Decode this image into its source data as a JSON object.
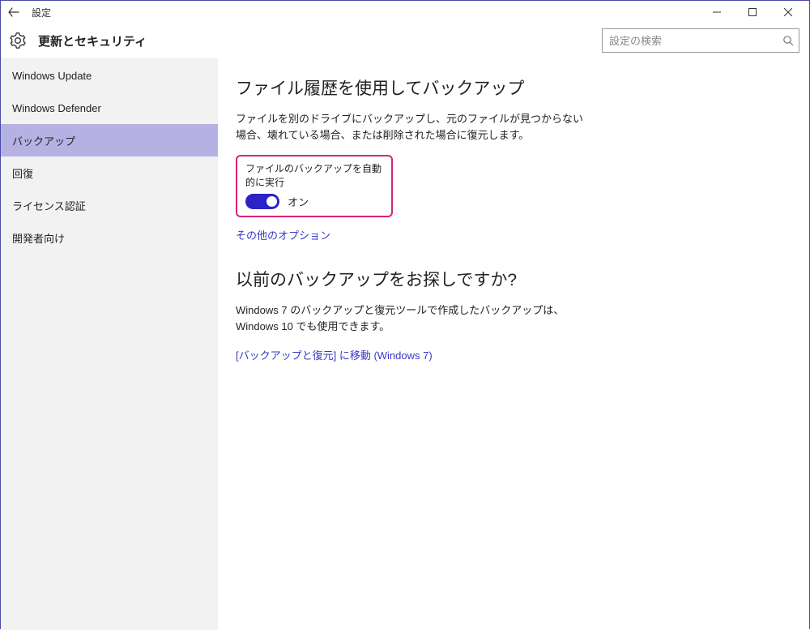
{
  "window": {
    "title": "設定"
  },
  "header": {
    "page_title": "更新とセキュリティ",
    "search_placeholder": "設定の検索"
  },
  "sidebar": {
    "items": [
      {
        "label": "Windows Update"
      },
      {
        "label": "Windows Defender"
      },
      {
        "label": "バックアップ"
      },
      {
        "label": "回復"
      },
      {
        "label": "ライセンス認証"
      },
      {
        "label": "開発者向け"
      }
    ],
    "selected_index": 2
  },
  "main": {
    "section1": {
      "heading": "ファイル履歴を使用してバックアップ",
      "description": "ファイルを別のドライブにバックアップし、元のファイルが見つからない場合、壊れている場合、または削除された場合に復元します。",
      "toggle_label": "ファイルのバックアップを自動的に実行",
      "toggle_state": "オン",
      "more_options_link": "その他のオプション"
    },
    "section2": {
      "heading": "以前のバックアップをお探しですか?",
      "description": "Windows 7 のバックアップと復元ツールで作成したバックアップは、Windows 10 でも使用できます。",
      "link": "[バックアップと復元] に移動 (Windows 7)"
    }
  }
}
